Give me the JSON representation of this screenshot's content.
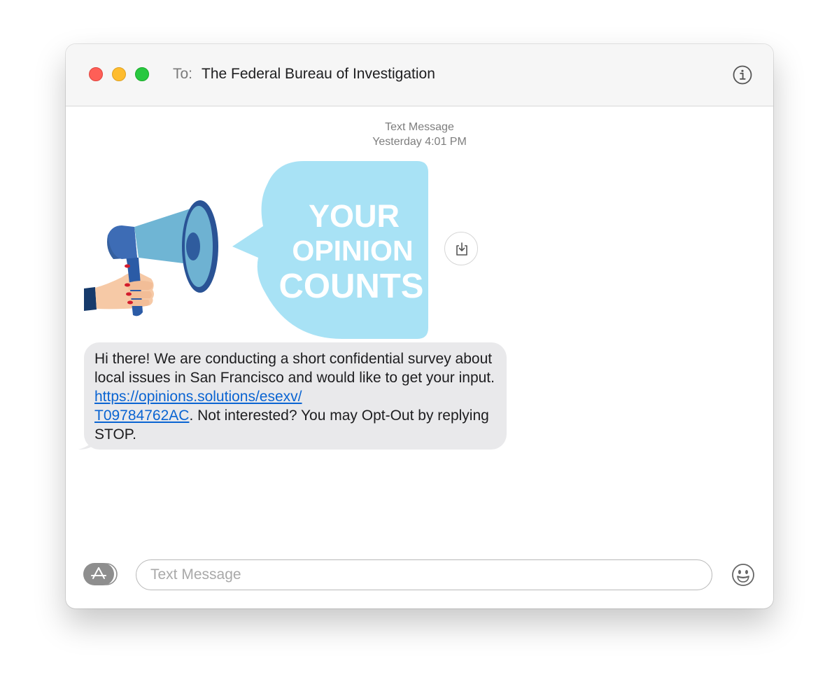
{
  "window": {
    "to_label": "To:",
    "recipient": "The Federal Bureau of Investigation"
  },
  "conversation": {
    "message_kind": "Text Message",
    "timestamp": "Yesterday 4:01 PM",
    "image": {
      "line1": "YOUR",
      "line2": "OPINION",
      "line3": "COUNTS"
    },
    "message": {
      "text_before_link": "Hi there! We are conducting a short confidential survey about local issues in San Francisco and would like to get your input. ",
      "link_part1": "https://opinions.solutions/esexv/",
      "link_part2": "T09784762AC",
      "text_after_link": ". Not interested? You may Opt-Out by replying STOP."
    }
  },
  "composer": {
    "placeholder": "Text Message"
  },
  "icons": {
    "info": "info-icon",
    "save": "save-download-icon",
    "apps": "app-store-icon",
    "emoji": "emoji-icon"
  },
  "colors": {
    "bubble_bg": "#e9e9eb",
    "link": "#0a64d2",
    "speech_bubble": "#a8e2f5"
  }
}
